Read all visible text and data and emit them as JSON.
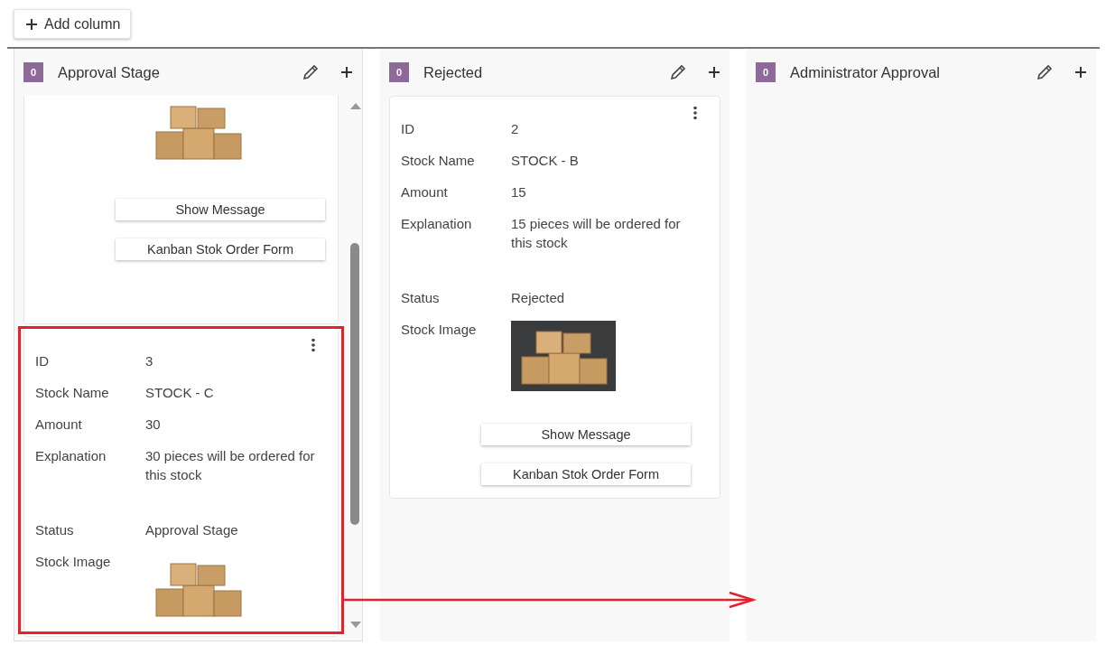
{
  "toolbar": {
    "add_column_button": "Add column"
  },
  "columns": [
    {
      "title": "Approval Stage",
      "count": "0",
      "scrollbar": true,
      "cards": [
        {
          "menu": false,
          "image": {
            "kind": "light"
          },
          "buttons": [
            "Show Message",
            "Kanban Stok Order Form"
          ],
          "highlighted": false
        },
        {
          "menu": true,
          "fields": [
            {
              "label": "ID",
              "value": "3"
            },
            {
              "label": "Stock Name",
              "value": "STOCK - C"
            },
            {
              "label": "Amount",
              "value": "30"
            },
            {
              "label": "Explanation",
              "value": "30 pieces will be ordered for this stock"
            },
            {
              "label": "Status",
              "value": "Approval Stage"
            },
            {
              "label": "Stock Image"
            }
          ],
          "image": {
            "kind": "light"
          },
          "highlighted": true
        }
      ]
    },
    {
      "title": "Rejected",
      "count": "0",
      "scrollbar": false,
      "cards": [
        {
          "menu": true,
          "fields": [
            {
              "label": "ID",
              "value": "2"
            },
            {
              "label": "Stock Name",
              "value": "STOCK - B"
            },
            {
              "label": "Amount",
              "value": "15"
            },
            {
              "label": "Explanation",
              "value": "15 pieces will be ordered for this stock"
            },
            {
              "label": "Status",
              "value": "Rejected"
            },
            {
              "label": "Stock Image"
            }
          ],
          "image": {
            "kind": "dark"
          },
          "buttons": [
            "Show Message",
            "Kanban Stok Order Form"
          ],
          "highlighted": false
        }
      ]
    },
    {
      "title": "Administrator Approval",
      "count": "0",
      "scrollbar": false
    }
  ]
}
